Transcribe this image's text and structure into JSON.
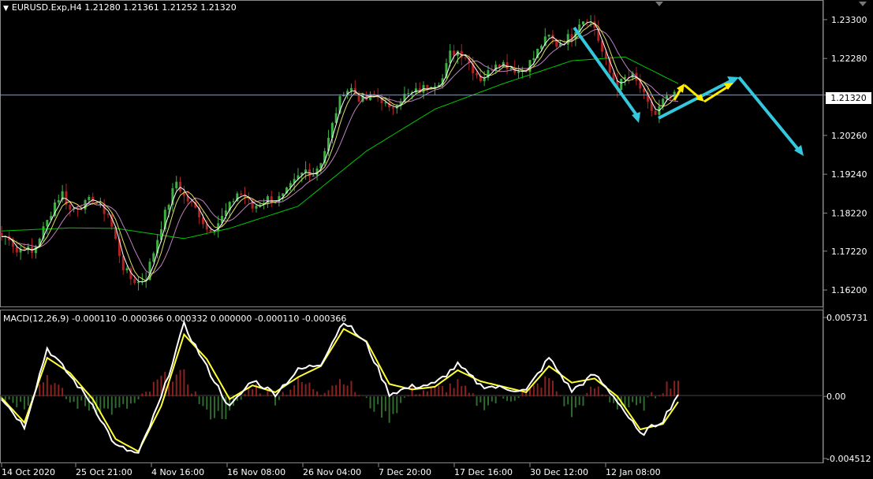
{
  "header": {
    "symbol_line": "EURUSD.Exp,H4  1.21280 1.21361 1.21252 1.21320"
  },
  "macd_header": {
    "text": "MACD(12,26,9) -0.000110 -0.000366 0.000332 0.000000 -0.000110 -0.000366"
  },
  "current_price_label": "1.21320",
  "colors": {
    "background": "#000000",
    "bull_candle": "#3cb043",
    "bear_candle": "#b22222",
    "ma_slow": "#00c800",
    "ma_fast1": "#ffffff",
    "ma_fast2": "#e0e060",
    "ma_mid": "#c080c0",
    "arrow_cyan": "#33c8dd",
    "arrow_yellow": "#ffee00",
    "macd_pos": "#8b2020",
    "macd_neg": "#2f6b2f",
    "macd_line": "#ffffff",
    "signal_line": "#ffff33"
  },
  "chart_data": [
    {
      "type": "candlestick",
      "title": "EURUSD.Exp,H4",
      "y_ticks": [
        "1.23300",
        "1.22280",
        "1.21320",
        "1.20260",
        "1.19240",
        "1.18220",
        "1.17220",
        "1.16200"
      ],
      "ylim": [
        1.1585,
        1.2365
      ],
      "x_ticks": [
        "14 Oct 2020",
        "25 Oct 21:00",
        "4 Nov 16:00",
        "16 Nov 08:00",
        "26 Nov 04:00",
        "7 Dec 20:00",
        "17 Dec 16:00",
        "30 Dec 12:00",
        "12 Jan 08:00"
      ],
      "last_price": 1.2132,
      "price_path": [
        [
          0,
          1.176
        ],
        [
          2,
          1.176
        ],
        [
          4,
          1.172
        ],
        [
          6,
          1.1735
        ],
        [
          8,
          1.1715
        ],
        [
          10,
          1.176
        ],
        [
          12,
          1.18
        ],
        [
          14,
          1.185
        ],
        [
          16,
          1.1875
        ],
        [
          18,
          1.183
        ],
        [
          20,
          1.184
        ],
        [
          22,
          1.1845
        ],
        [
          24,
          1.186
        ],
        [
          26,
          1.1835
        ],
        [
          28,
          1.182
        ],
        [
          30,
          1.175
        ],
        [
          32,
          1.168
        ],
        [
          34,
          1.165
        ],
        [
          36,
          1.164
        ],
        [
          38,
          1.1655
        ],
        [
          40,
          1.172
        ],
        [
          42,
          1.179
        ],
        [
          44,
          1.185
        ],
        [
          46,
          1.1905
        ],
        [
          48,
          1.1865
        ],
        [
          50,
          1.1845
        ],
        [
          52,
          1.182
        ],
        [
          54,
          1.178
        ],
        [
          56,
          1.1785
        ],
        [
          58,
          1.181
        ],
        [
          60,
          1.184
        ],
        [
          62,
          1.1875
        ],
        [
          64,
          1.1865
        ],
        [
          66,
          1.1835
        ],
        [
          68,
          1.185
        ],
        [
          70,
          1.186
        ],
        [
          72,
          1.1855
        ],
        [
          74,
          1.1865
        ],
        [
          76,
          1.189
        ],
        [
          78,
          1.1915
        ],
        [
          80,
          1.1935
        ],
        [
          82,
          1.1925
        ],
        [
          84,
          1.196
        ],
        [
          86,
          1.2015
        ],
        [
          88,
          1.209
        ],
        [
          90,
          1.2145
        ],
        [
          92,
          1.2148
        ],
        [
          94,
          1.2125
        ],
        [
          96,
          1.212
        ],
        [
          98,
          1.213
        ],
        [
          100,
          1.212
        ],
        [
          102,
          1.209
        ],
        [
          104,
          1.2115
        ],
        [
          106,
          1.213
        ],
        [
          108,
          1.2135
        ],
        [
          110,
          1.2145
        ],
        [
          112,
          1.2155
        ],
        [
          114,
          1.2165
        ],
        [
          116,
          1.2175
        ],
        [
          118,
          1.224
        ],
        [
          120,
          1.2248
        ],
        [
          122,
          1.2235
        ],
        [
          124,
          1.22
        ],
        [
          126,
          1.2175
        ],
        [
          128,
          1.219
        ],
        [
          130,
          1.222
        ],
        [
          132,
          1.2215
        ],
        [
          134,
          1.2205
        ],
        [
          136,
          1.2195
        ],
        [
          138,
          1.2205
        ],
        [
          140,
          1.223
        ],
        [
          142,
          1.2265
        ],
        [
          144,
          1.2285
        ],
        [
          146,
          1.2265
        ],
        [
          148,
          1.2275
        ],
        [
          150,
          1.229
        ],
        [
          152,
          1.2325
        ],
        [
          154,
          1.2335
        ],
        [
          156,
          1.231
        ],
        [
          158,
          1.2245
        ],
        [
          160,
          1.219
        ],
        [
          162,
          1.2155
        ],
        [
          164,
          1.2175
        ],
        [
          166,
          1.218
        ],
        [
          168,
          1.215
        ],
        [
          170,
          1.2105
        ],
        [
          172,
          1.208
        ],
        [
          174,
          1.2115
        ],
        [
          176,
          1.2125
        ],
        [
          178,
          1.2132
        ]
      ],
      "series": [
        {
          "name": "",
          "values": [
            [
              0,
              1.1775
            ],
            [
              18,
              1.1783
            ],
            [
              30,
              1.1782
            ],
            [
              48,
              1.1755
            ],
            [
              60,
              1.1782
            ],
            [
              78,
              1.184
            ],
            [
              96,
              1.1985
            ],
            [
              114,
              1.2095
            ],
            [
              132,
              1.2162
            ],
            [
              150,
              1.2222
            ],
            [
              164,
              1.2232
            ],
            [
              178,
              1.2162
            ]
          ]
        }
      ]
    },
    {
      "type": "histogram+line",
      "title": "MACD(12,26,9)",
      "y_ticks": [
        "0.005731",
        "0.00",
        "-0.004512"
      ],
      "ylim": [
        -0.004512,
        0.005731
      ],
      "macd": [
        [
          0,
          -0.0001
        ],
        [
          6,
          -0.0022
        ],
        [
          12,
          0.0035
        ],
        [
          18,
          0.0015
        ],
        [
          24,
          -0.0006
        ],
        [
          30,
          -0.0036
        ],
        [
          36,
          -0.0042
        ],
        [
          42,
          -0.0001
        ],
        [
          48,
          0.0052
        ],
        [
          54,
          0.0021
        ],
        [
          60,
          -0.0008
        ],
        [
          66,
          0.0012
        ],
        [
          72,
          0.0002
        ],
        [
          78,
          0.0019
        ],
        [
          84,
          0.0024
        ],
        [
          90,
          0.0055
        ],
        [
          96,
          0.0038
        ],
        [
          102,
          0.0002
        ],
        [
          108,
          0.0007
        ],
        [
          114,
          0.0009
        ],
        [
          120,
          0.0023
        ],
        [
          126,
          0.0008
        ],
        [
          132,
          0.0006
        ],
        [
          138,
          0.0004
        ],
        [
          144,
          0.0028
        ],
        [
          150,
          0.0004
        ],
        [
          156,
          0.0016
        ],
        [
          162,
          -0.0003
        ],
        [
          168,
          -0.0028
        ],
        [
          174,
          -0.0017
        ],
        [
          178,
          0.0002
        ]
      ],
      "signal": [
        [
          0,
          -0.0001
        ],
        [
          6,
          -0.0019
        ],
        [
          12,
          0.0028
        ],
        [
          18,
          0.0017
        ],
        [
          24,
          -0.0002
        ],
        [
          30,
          -0.0031
        ],
        [
          36,
          -0.004
        ],
        [
          42,
          -0.0007
        ],
        [
          48,
          0.0045
        ],
        [
          54,
          0.0027
        ],
        [
          60,
          -0.0002
        ],
        [
          66,
          0.0008
        ],
        [
          72,
          0.0003
        ],
        [
          78,
          0.0014
        ],
        [
          84,
          0.0022
        ],
        [
          90,
          0.0049
        ],
        [
          96,
          0.004
        ],
        [
          102,
          0.0009
        ],
        [
          108,
          0.0005
        ],
        [
          114,
          0.0007
        ],
        [
          120,
          0.0019
        ],
        [
          126,
          0.0011
        ],
        [
          132,
          0.0007
        ],
        [
          138,
          0.0003
        ],
        [
          144,
          0.0022
        ],
        [
          150,
          0.001
        ],
        [
          156,
          0.0013
        ],
        [
          162,
          0.0
        ],
        [
          168,
          -0.0024
        ],
        [
          174,
          -0.002
        ],
        [
          178,
          -0.0004
        ]
      ]
    }
  ]
}
